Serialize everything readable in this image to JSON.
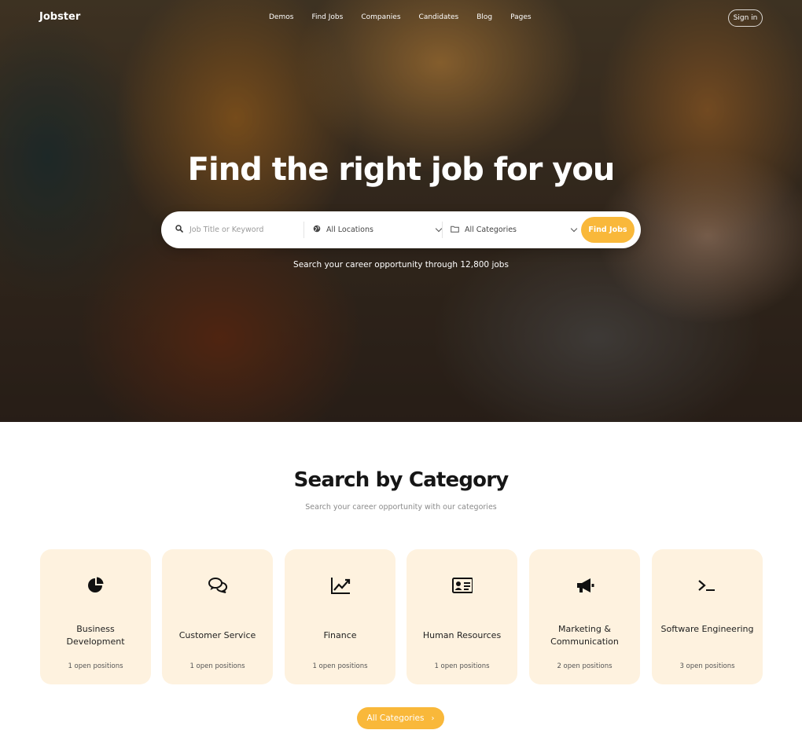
{
  "nav": {
    "logo": "Jobster",
    "items": [
      "Demos",
      "Find Jobs",
      "Companies",
      "Candidates",
      "Blog",
      "Pages"
    ],
    "signin": "Sign in"
  },
  "hero": {
    "title": "Find the right job for you",
    "search": {
      "keyword_placeholder": "Job Title or Keyword",
      "location_value": "All Locations",
      "category_value": "All Categories",
      "button": "Find Jobs"
    },
    "subtitle": "Search your career opportunity through 12,800 jobs"
  },
  "categories": {
    "title": "Search by Category",
    "subtitle": "Search your career opportunity with our categories",
    "items": [
      {
        "name": "Business Development",
        "count": "1 open positions",
        "icon": "pie-chart-icon"
      },
      {
        "name": "Customer Service",
        "count": "1 open positions",
        "icon": "chat-bubbles-icon"
      },
      {
        "name": "Finance",
        "count": "1 open positions",
        "icon": "line-chart-icon"
      },
      {
        "name": "Human Resources",
        "count": "1 open positions",
        "icon": "id-card-icon"
      },
      {
        "name": "Marketing & Communication",
        "count": "2 open positions",
        "icon": "megaphone-icon"
      },
      {
        "name": "Software Engineering",
        "count": "3 open positions",
        "icon": "terminal-icon"
      }
    ],
    "all_button": "All Categories"
  },
  "colors": {
    "accent": "#f9b83a",
    "card_bg": "#fef2df"
  }
}
